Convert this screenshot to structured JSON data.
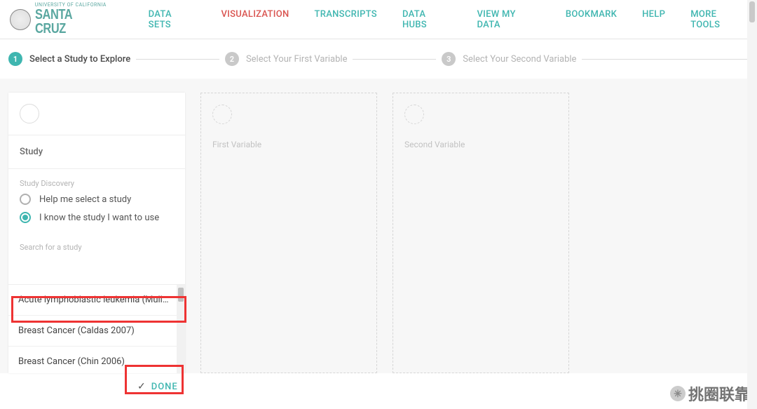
{
  "logo": {
    "top": "UNIVERSITY OF CALIFORNIA",
    "bottom": "SANTA CRUZ"
  },
  "nav": {
    "items": [
      "DATA SETS",
      "VISUALIZATION",
      "TRANSCRIPTS",
      "DATA HUBS",
      "VIEW MY DATA",
      "BOOKMARK",
      "HELP",
      "MORE TOOLS"
    ],
    "active_index": 1
  },
  "steps": {
    "s1": {
      "num": "1",
      "label": "Select a Study to Explore"
    },
    "s2": {
      "num": "2",
      "label": "Select Your First Variable"
    },
    "s3": {
      "num": "3",
      "label": "Select Your Second Variable"
    }
  },
  "study_panel": {
    "title": "Study",
    "discovery_label": "Study Discovery",
    "option_help": "Help me select a study",
    "option_know": "I know the study I want to use",
    "search_label": "Search for a study",
    "results": [
      "Acute lymphoblastic leukemia (Mull…",
      "Breast Cancer (Caldas 2007)",
      "Breast Cancer (Chin 2006)"
    ]
  },
  "ghost": {
    "first": "First Variable",
    "second": "Second Variable"
  },
  "done": {
    "label": "DONE"
  },
  "watermark": "挑圈联靠"
}
